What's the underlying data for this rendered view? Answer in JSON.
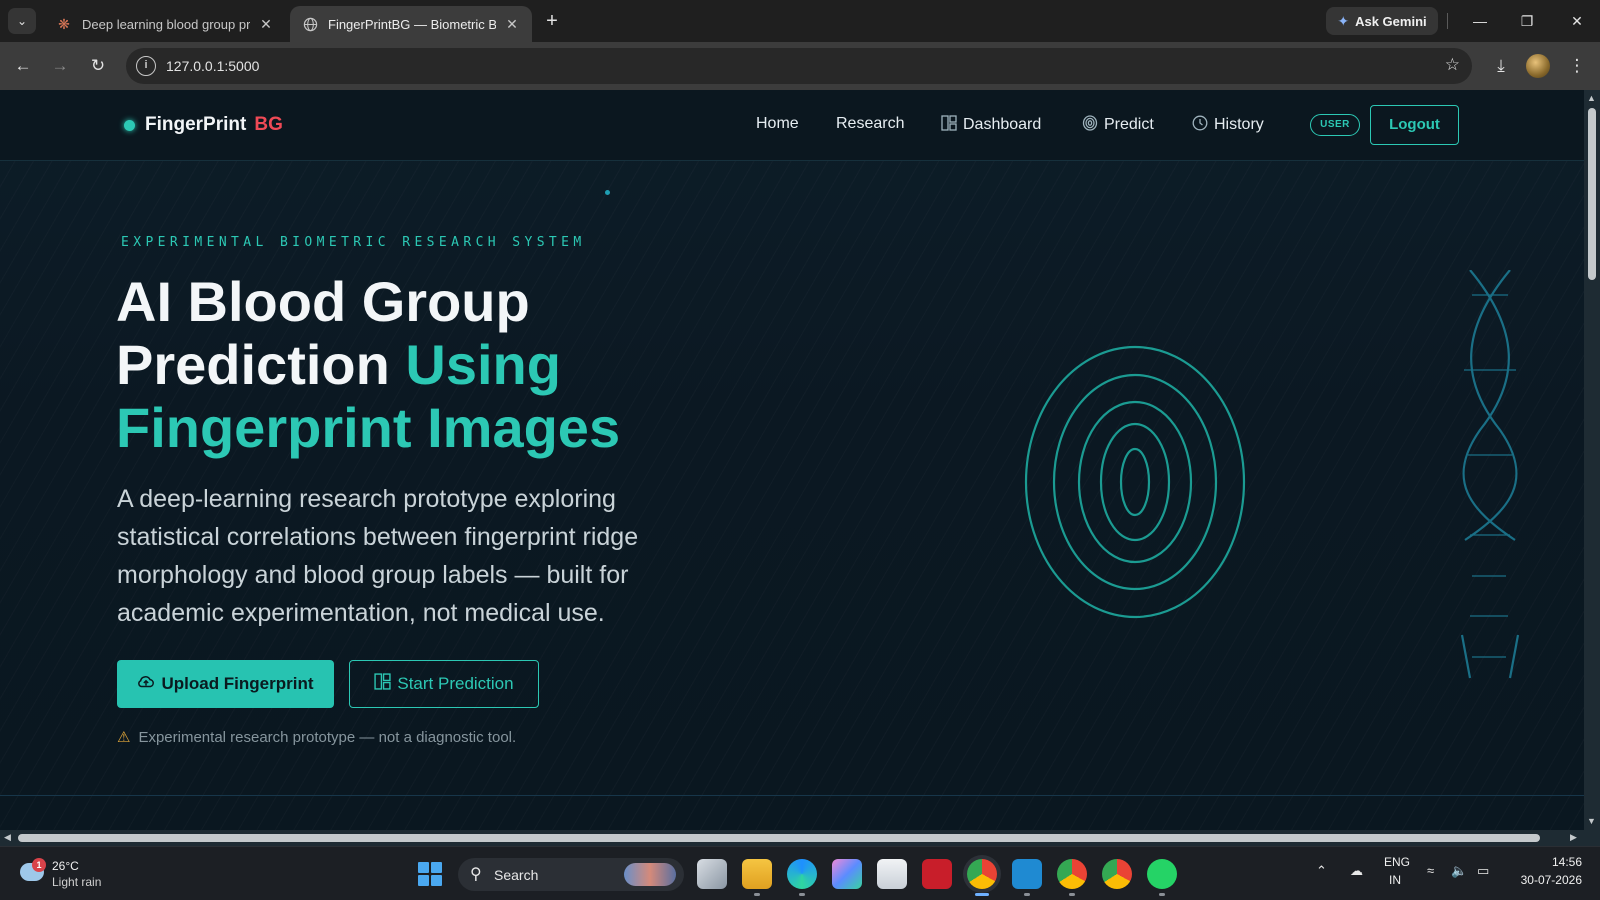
{
  "browser": {
    "tabs": [
      {
        "title": "Deep learning blood group pre",
        "active": false,
        "favicon": "claude-asterisk-icon"
      },
      {
        "title": "FingerPrintBG — Biometric Bloo",
        "active": true,
        "favicon": "globe-icon"
      }
    ],
    "ask_gemini": "Ask Gemini",
    "url": "127.0.0.1:5000"
  },
  "site": {
    "brand": {
      "name": "FingerPrint",
      "suffix": "BG"
    },
    "nav": [
      {
        "label": "Home",
        "icon": ""
      },
      {
        "label": "Research",
        "icon": ""
      },
      {
        "label": "Dashboard",
        "icon": "grid-icon"
      },
      {
        "label": "Predict",
        "icon": "fingerprint-icon"
      },
      {
        "label": "History",
        "icon": "clock-icon"
      }
    ],
    "role_badge": "USER",
    "logout": "Logout"
  },
  "hero": {
    "eyebrow": "EXPERIMENTAL BIOMETRIC RESEARCH SYSTEM",
    "title_plain": "AI Blood Group Prediction ",
    "title_accent": "Using Fingerprint Images",
    "description": "A deep-learning research prototype exploring statistical correlations between fingerprint ridge morphology and blood group labels — built for academic experimentation, not medical use.",
    "upload_btn": "Upload Fingerprint",
    "start_btn": "Start Prediction",
    "disclaimer": "Experimental research prototype — not a diagnostic tool."
  },
  "taskbar": {
    "weather_temp": "26°C",
    "weather_desc": "Light rain",
    "weather_badge": "1",
    "search": "Search",
    "lang": "ENG",
    "region": "IN",
    "time": "14:56",
    "date": "30-07-2026"
  },
  "colors": {
    "accent": "#2cc8b4",
    "brand_red": "#ef4a56",
    "background": "#0b1822"
  }
}
